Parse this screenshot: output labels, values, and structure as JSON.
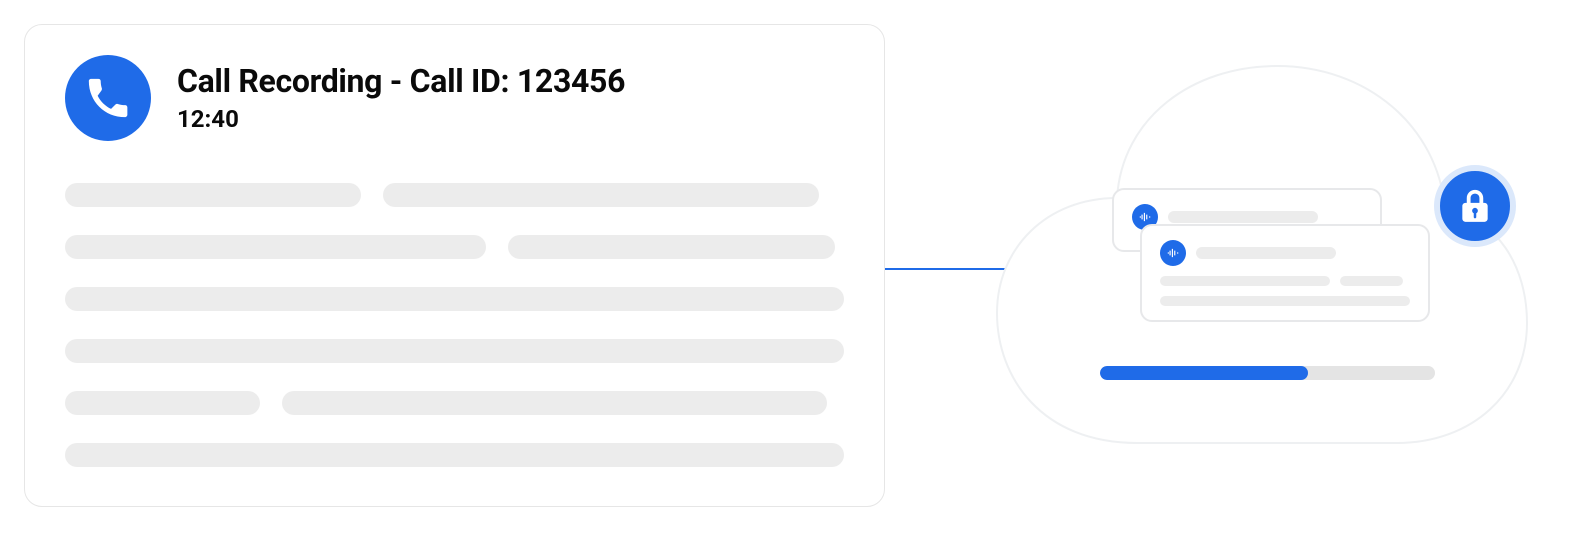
{
  "colors": {
    "accent": "#1F6BE8",
    "skeleton": "#ececec"
  },
  "call": {
    "title": "Call Recording - Call ID: 123456",
    "time": "12:40",
    "icon_name": "phone-icon"
  },
  "cloud": {
    "lock_icon_name": "lock-icon",
    "mini_card_icon_name": "audio-wave-icon",
    "progress_percent": 62
  }
}
